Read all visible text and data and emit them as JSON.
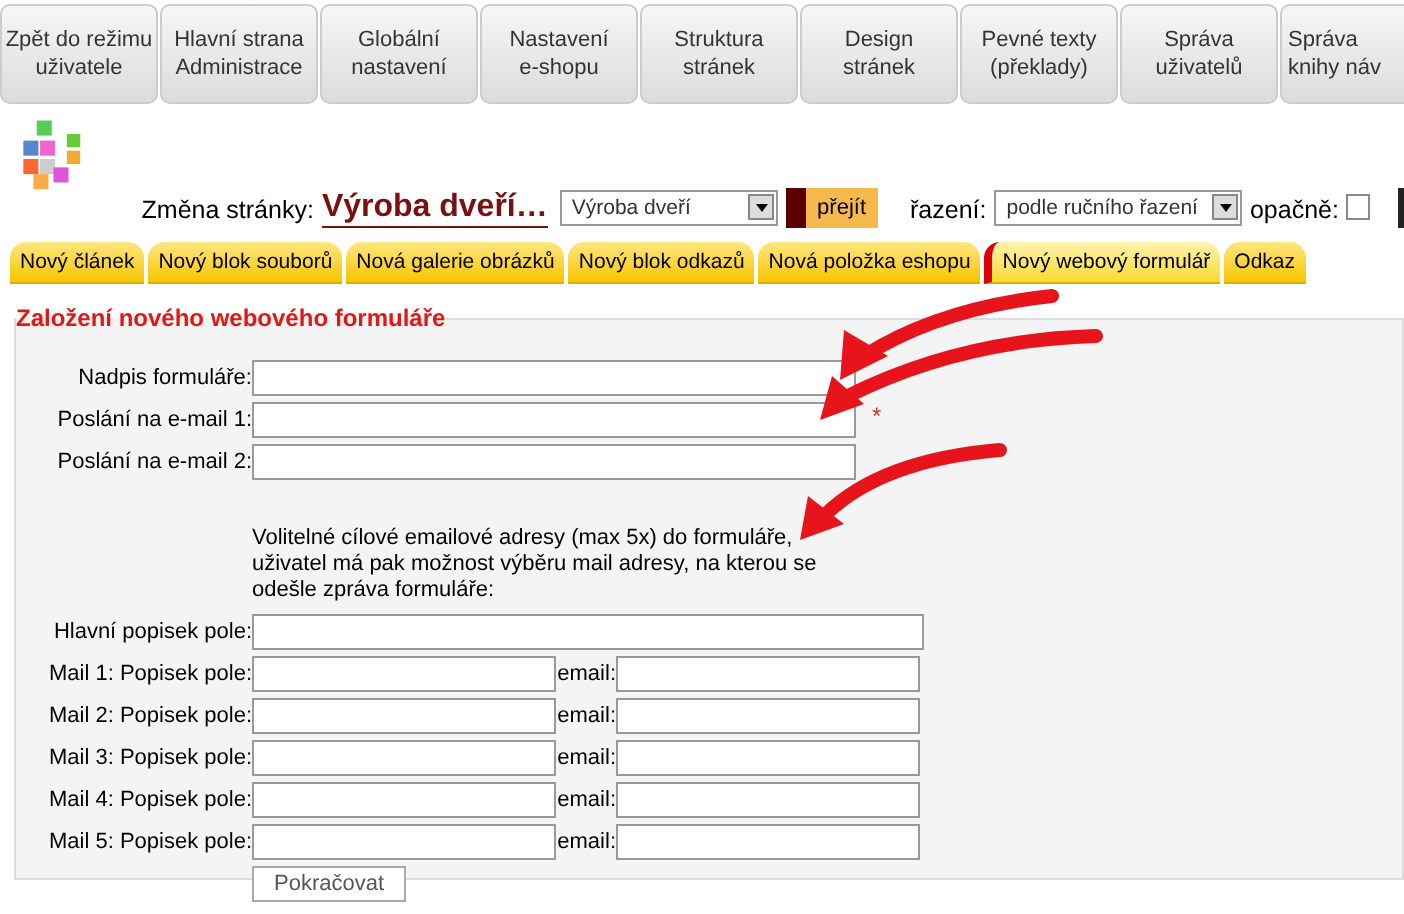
{
  "nav_tabs": [
    {
      "lines": [
        "Zpět do režimu",
        "uživatele"
      ]
    },
    {
      "lines": [
        "Hlavní strana",
        "Administrace"
      ]
    },
    {
      "lines": [
        "Globální",
        "nastavení"
      ]
    },
    {
      "lines": [
        "Nastavení",
        "e-shopu"
      ]
    },
    {
      "lines": [
        "Struktura",
        "stránek"
      ]
    },
    {
      "lines": [
        "Design",
        "stránek"
      ]
    },
    {
      "lines": [
        "Pevné texty",
        "(překlady)"
      ]
    },
    {
      "lines": [
        "Správa",
        "uživatelů"
      ]
    },
    {
      "lines": [
        "Správa",
        "knihy náv"
      ]
    }
  ],
  "page_switch": {
    "label": "Změna stránky:",
    "current_page": "Výroba dveří…",
    "page_select": "Výroba dveří",
    "go_button": "přejít",
    "sort_label": "řazení:",
    "sort_select": "podle ručního řazení",
    "reverse_label": "opačně:",
    "reverse_checked": false
  },
  "content_tabs": [
    {
      "label": "Nový článek",
      "selected": false
    },
    {
      "label": "Nový blok souborů",
      "selected": false
    },
    {
      "label": "Nová galerie obrázků",
      "selected": false
    },
    {
      "label": "Nový blok odkazů",
      "selected": false
    },
    {
      "label": "Nová položka eshopu",
      "selected": false
    },
    {
      "label": "Nový webový formulář",
      "selected": true
    },
    {
      "label": "Odkaz",
      "selected": false
    }
  ],
  "form": {
    "legend": "Založení nového webového formuláře",
    "fields": [
      {
        "label": "Nadpis formuláře:"
      },
      {
        "label": "Poslání na e-mail 1:",
        "required_mark": "*"
      },
      {
        "label": "Poslání na e-mail 2:"
      }
    ],
    "note": "Volitelné cílové emailové adresy (max 5x) do formuláře, uživatel má pak možnost výběru mail adresy, na kterou se odešle zpráva formuláře:",
    "main_label": "Hlavní popisek pole:",
    "mail_rows": [
      {
        "label": "Mail 1: Popisek pole:",
        "email_label": "email:"
      },
      {
        "label": "Mail 2: Popisek pole:",
        "email_label": "email:"
      },
      {
        "label": "Mail 3: Popisek pole:",
        "email_label": "email:"
      },
      {
        "label": "Mail 4: Popisek pole:",
        "email_label": "email:"
      },
      {
        "label": "Mail 5: Popisek pole:",
        "email_label": "email:"
      }
    ],
    "submit": "Pokračovat"
  }
}
